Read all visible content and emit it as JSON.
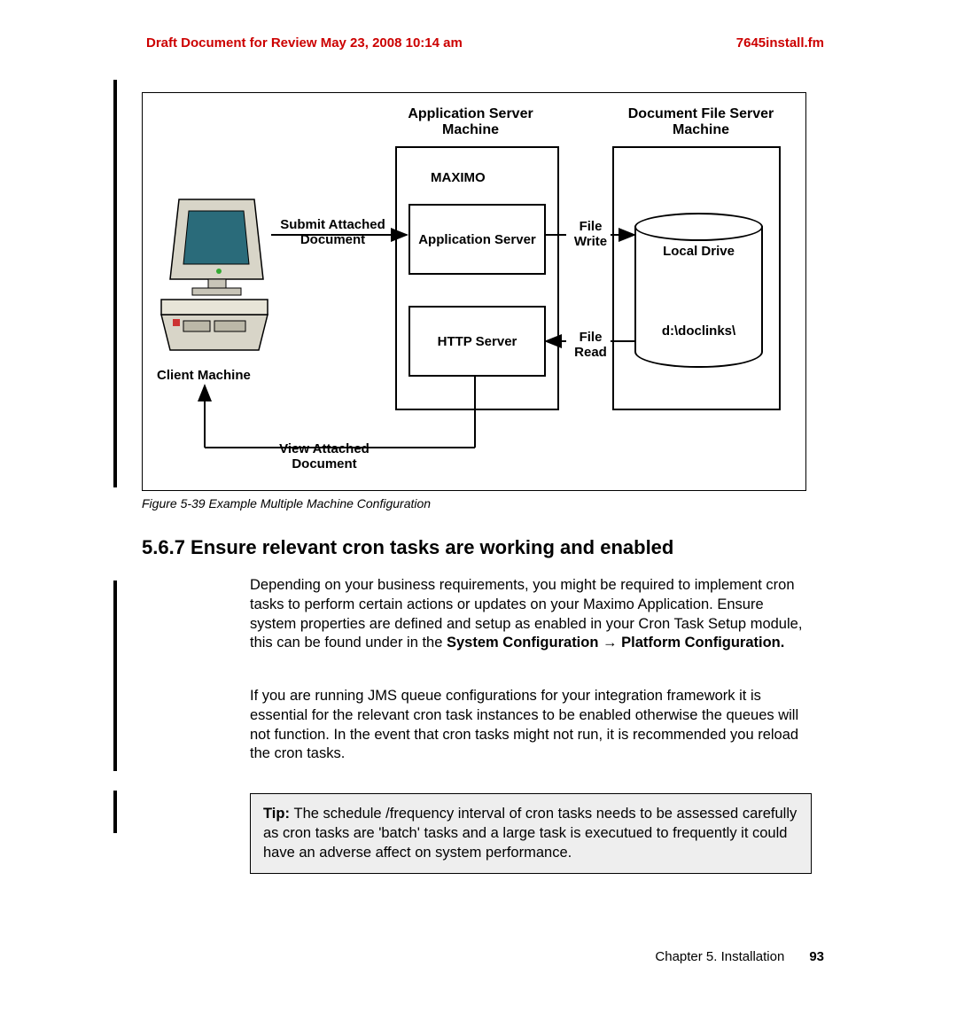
{
  "header": {
    "left": "Draft Document for Review May 23, 2008 10:14 am",
    "right": "7645install.fm"
  },
  "figure": {
    "appServerTitle": "Application Server Machine",
    "docFileTitle": "Document File Server Machine",
    "maximo": "MAXIMO",
    "appServerBox": "Application Server",
    "httpServerBox": "HTTP Server",
    "localDrive": "Local Drive",
    "doclinks": "d:\\doclinks\\",
    "clientMachine": "Client Machine",
    "submit": "Submit Attached Document",
    "view": "View Attached Document",
    "fileWrite": "File Write",
    "fileRead": "File Read",
    "caption": "Figure 5-39   Example Multiple Machine Configuration"
  },
  "section": {
    "heading": "5.6.7  Ensure relevant cron tasks are working and enabled",
    "para1_a": "Depending on your business requirements, you might be required to implement cron tasks to perform certain actions or updates on your Maximo Application. Ensure system properties are defined and setup as enabled in your Cron Task Setup module, this can be found under in the ",
    "para1_b": "System Configuration",
    "para1_arrow": " → ",
    "para1_c": "Platform Configuration.",
    "para2": "If you are running JMS queue configurations for your integration framework it is essential for the relevant cron task instances to be enabled otherwise the queues will not function. In the event that cron tasks might not run, it is recommended you reload the cron tasks.",
    "tip_label": "Tip: ",
    "tip_text": "The schedule /frequency interval of cron tasks needs to be assessed carefully as cron tasks are 'batch' tasks and a large task is executued to frequently it could have an adverse affect on system performance."
  },
  "footer": {
    "chapter": "Chapter 5. Installation",
    "page": "93"
  }
}
